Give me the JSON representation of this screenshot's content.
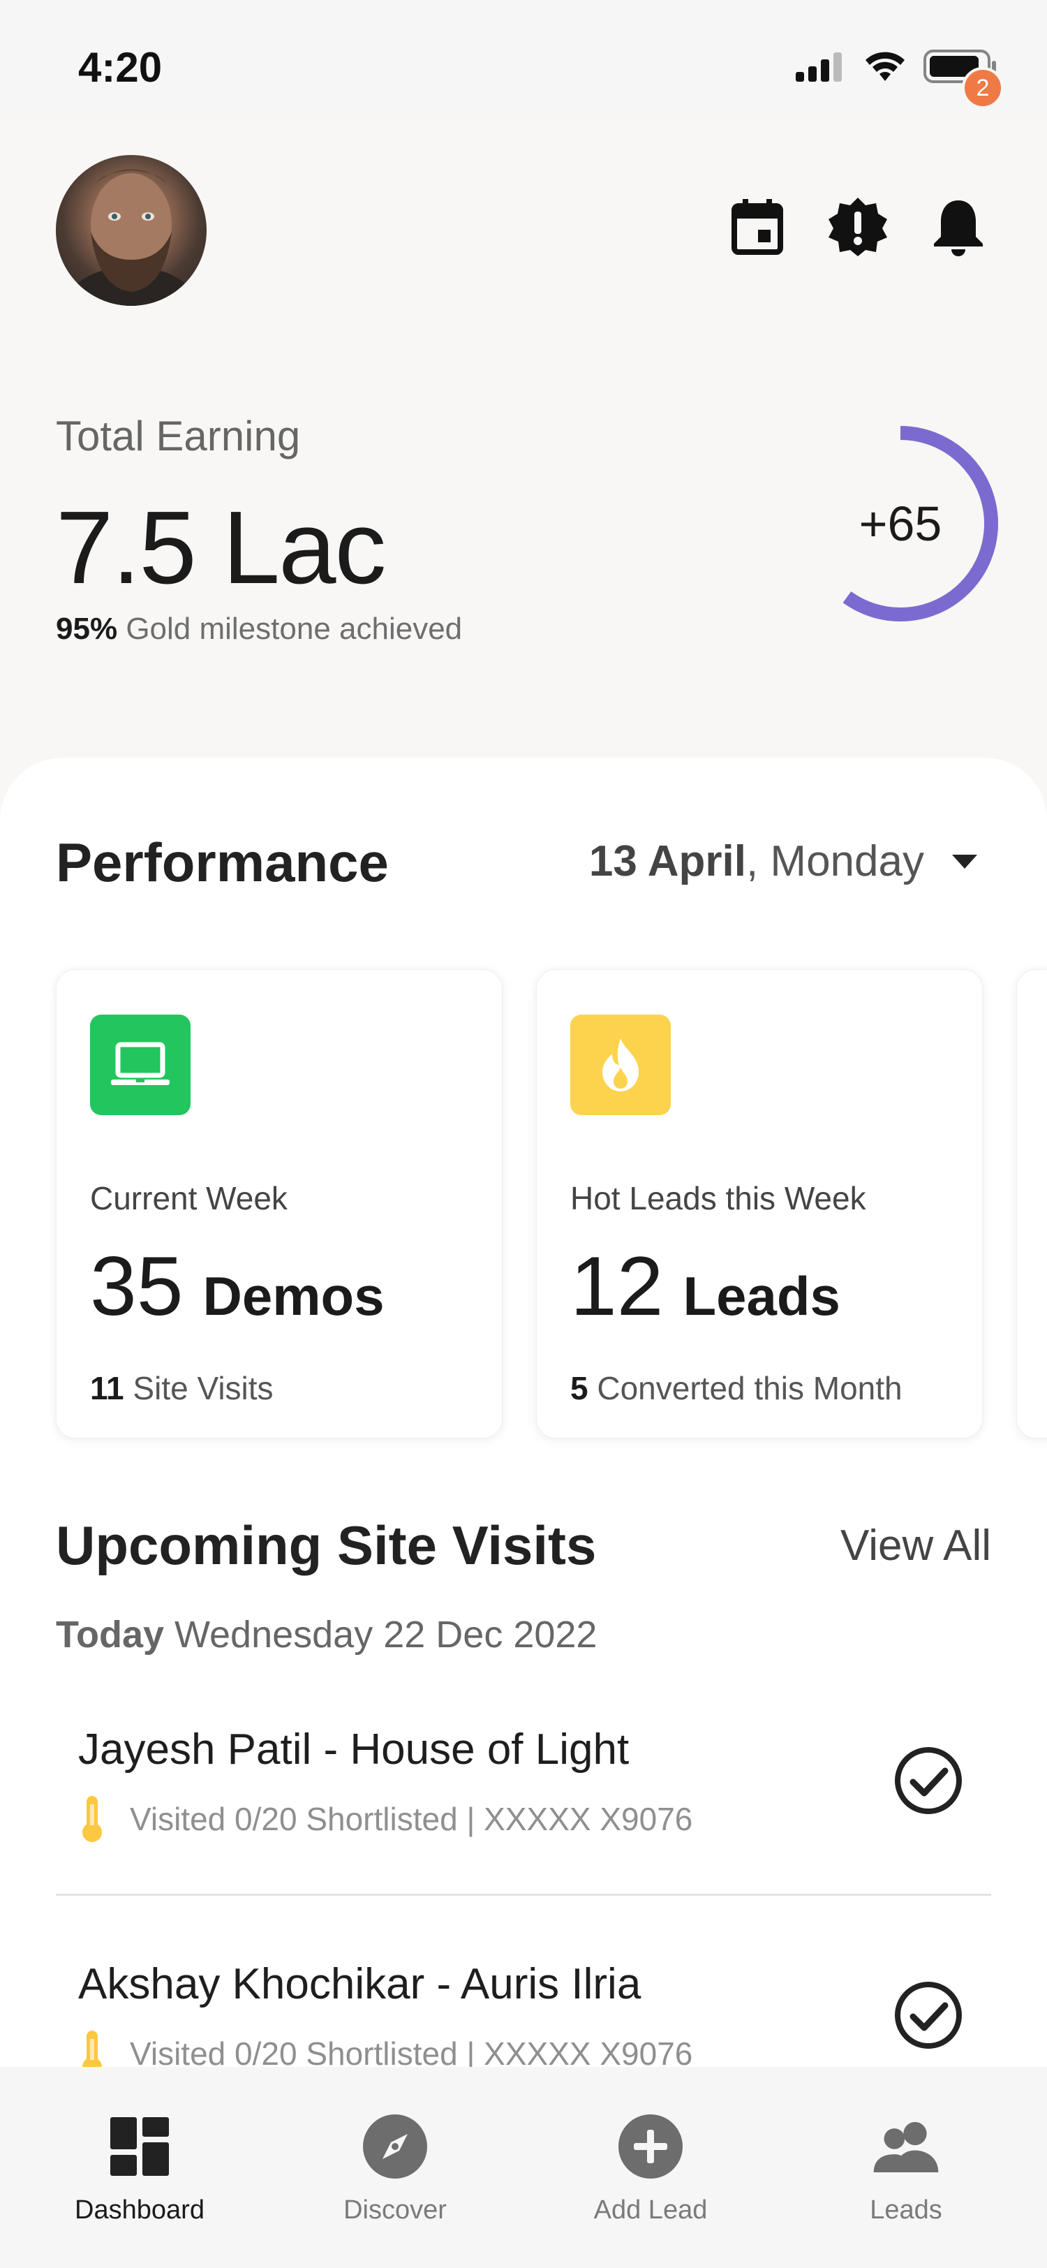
{
  "status": {
    "time": "4:20"
  },
  "header": {
    "notification_count": "2"
  },
  "earning": {
    "label": "Total Earning",
    "value": "7.5 Lac",
    "milestone_pct": "95%",
    "milestone_text": "Gold milestone achieved",
    "ring_value": "+65",
    "ring_progress": 0.6,
    "ring_color": "#7b6bd0"
  },
  "performance": {
    "title": "Performance",
    "date_bold": "13 April",
    "date_rest": ", Monday",
    "cards": [
      {
        "icon": "laptop-icon",
        "icon_bg": "#22c55e",
        "label": "Current Week",
        "value": "35",
        "unit": "Demos",
        "sub_value": "11",
        "sub_text": "Site Visits"
      },
      {
        "icon": "fire-icon",
        "icon_bg": "#fcd34d",
        "label": "Hot Leads this Week",
        "value": "12",
        "unit": "Leads",
        "sub_value": "5",
        "sub_text": "Converted this Month"
      }
    ]
  },
  "visits": {
    "title": "Upcoming Site Visits",
    "view_all": "View All",
    "date_bold": "Today",
    "date_rest": "Wednesday 22 Dec 2022",
    "items": [
      {
        "name": "Jayesh Patil - House of Light",
        "meta": "Visited 0/20 Shortlisted | XXXXX X9076"
      },
      {
        "name": "Akshay Khochikar - Auris Ilria",
        "meta": "Visited 0/20 Shortlisted | XXXXX X9076"
      }
    ]
  },
  "tabs": [
    {
      "label": "Dashboard",
      "icon": "dashboard-icon",
      "active": true
    },
    {
      "label": "Discover",
      "icon": "compass-icon",
      "active": false
    },
    {
      "label": "Add Lead",
      "icon": "add-circle-icon",
      "active": false
    },
    {
      "label": "Leads",
      "icon": "people-icon",
      "active": false
    }
  ]
}
